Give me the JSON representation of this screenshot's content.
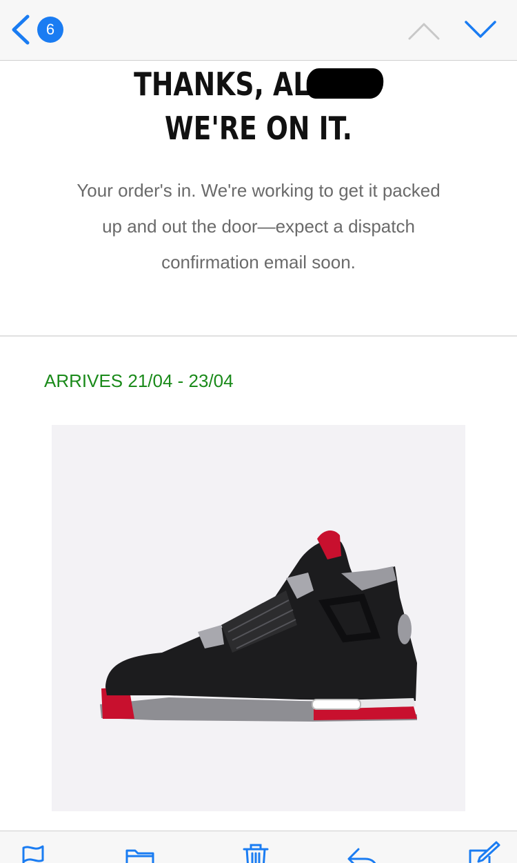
{
  "nav": {
    "back_badge": "6",
    "accent_color": "#1a7cf2",
    "icons": [
      "back-chevron-icon",
      "previous-message-icon",
      "next-message-icon"
    ]
  },
  "email": {
    "headline_line1": "THANKS, AL",
    "headline_line2": "WE'RE ON IT.",
    "intro": "Your order's in. We're working to get it packed up and out the door—expect a dispatch confirmation email soon.",
    "arrives": "ARRIVES 21/04 - 23/04",
    "arrives_color": "#1a8a1a",
    "product_image": "sneaker-image"
  },
  "toolbar": {
    "icons": [
      "flag-icon",
      "folder-icon",
      "trash-icon",
      "reply-icon",
      "compose-icon"
    ]
  }
}
